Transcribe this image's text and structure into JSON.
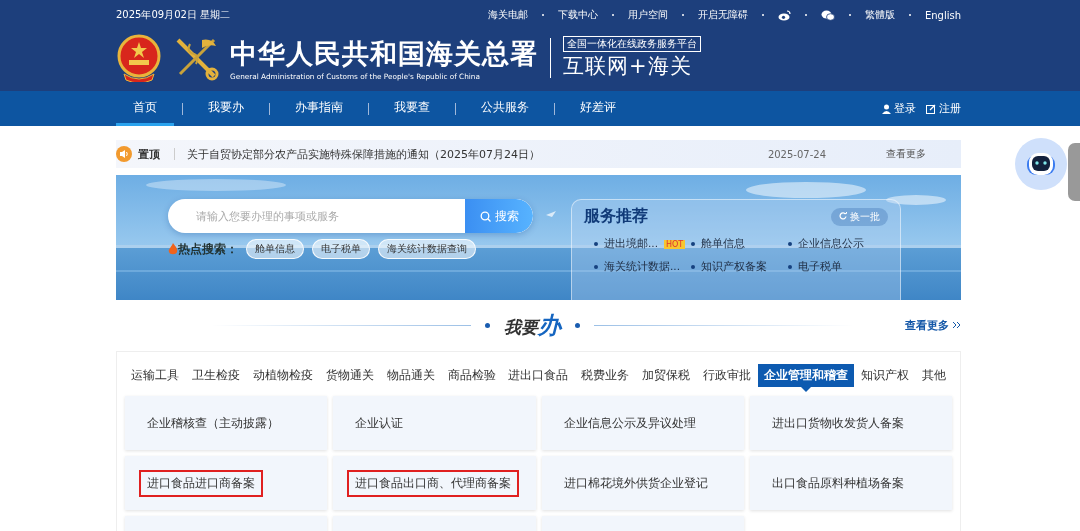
{
  "header": {
    "date": "2025年09月02日 星期二",
    "top_links": [
      {
        "kind": "text",
        "label": "海关电邮"
      },
      {
        "kind": "text",
        "label": "下载中心"
      },
      {
        "kind": "text",
        "label": "用户空间"
      },
      {
        "kind": "text",
        "label": "开启无障碍"
      },
      {
        "kind": "weibo"
      },
      {
        "kind": "wechat"
      },
      {
        "kind": "text",
        "label": "繁體版"
      },
      {
        "kind": "text",
        "label": "English"
      }
    ],
    "title": "中华人民共和国海关总署",
    "subtitle": "General Administration of Customs of the People's Republic of China",
    "platform": "全国一体化在线政务服务平台",
    "platform_name": "互联网+海关"
  },
  "nav": {
    "items": [
      {
        "label": "首页",
        "selected": true
      },
      {
        "label": "我要办",
        "selected": false
      },
      {
        "label": "办事指南",
        "selected": false
      },
      {
        "label": "我要查",
        "selected": false
      },
      {
        "label": "公共服务",
        "selected": false
      },
      {
        "label": "好差评",
        "selected": false
      }
    ],
    "login": "登录",
    "register": "注册"
  },
  "notice": {
    "tag": "置顶",
    "text": "关于自贸协定部分农产品实施特殊保障措施的通知（2025年07月24日）",
    "date": "2025-07-24",
    "more": "查看更多"
  },
  "banner": {
    "search": {
      "placeholder": "请输入您要办理的事项或服务",
      "button": "搜索"
    },
    "hot": {
      "label": "热点搜索：",
      "chips": [
        "舱单信息",
        "电子税单",
        "海关统计数据查询"
      ]
    },
    "services": {
      "title": "服务推荐",
      "refresh": "换一批",
      "items": [
        {
          "label": "进出境邮...",
          "badge": "HOT"
        },
        {
          "label": "舱单信息"
        },
        {
          "label": "企业信息公示"
        },
        {
          "label": "海关统计数据..."
        },
        {
          "label": "知识产权备案"
        },
        {
          "label": "电子税单"
        }
      ]
    }
  },
  "section": {
    "title_a": "我要",
    "title_b": "办",
    "more": "查看更多"
  },
  "tabs": [
    {
      "label": "运输工具",
      "selected": false
    },
    {
      "label": "卫生检疫",
      "selected": false
    },
    {
      "label": "动植物检疫",
      "selected": false
    },
    {
      "label": "货物通关",
      "selected": false
    },
    {
      "label": "物品通关",
      "selected": false
    },
    {
      "label": "商品检验",
      "selected": false
    },
    {
      "label": "进出口食品",
      "selected": false
    },
    {
      "label": "税费业务",
      "selected": false
    },
    {
      "label": "加贸保税",
      "selected": false
    },
    {
      "label": "行政审批",
      "selected": false
    },
    {
      "label": "企业管理和稽查",
      "selected": true
    },
    {
      "label": "知识产权",
      "selected": false
    },
    {
      "label": "其他",
      "selected": false
    }
  ],
  "cards": [
    {
      "kind": "service",
      "label": "企业稽核查（主动披露）",
      "highlighted": false
    },
    {
      "kind": "service",
      "label": "企业认证",
      "highlighted": false
    },
    {
      "kind": "service",
      "label": "企业信息公示及异议处理",
      "highlighted": false
    },
    {
      "kind": "service",
      "label": "进出口货物收发货人备案",
      "highlighted": false
    },
    {
      "kind": "service",
      "label": "进口食品进口商备案",
      "highlighted": true
    },
    {
      "kind": "service",
      "label": "进口食品出口商、代理商备案",
      "highlighted": true
    },
    {
      "kind": "service",
      "label": "进口棉花境外供货企业登记",
      "highlighted": false
    },
    {
      "kind": "service",
      "label": "出口食品原料种植场备案",
      "highlighted": false
    },
    {
      "kind": "blank"
    },
    {
      "kind": "blank"
    },
    {
      "kind": "blank"
    }
  ]
}
